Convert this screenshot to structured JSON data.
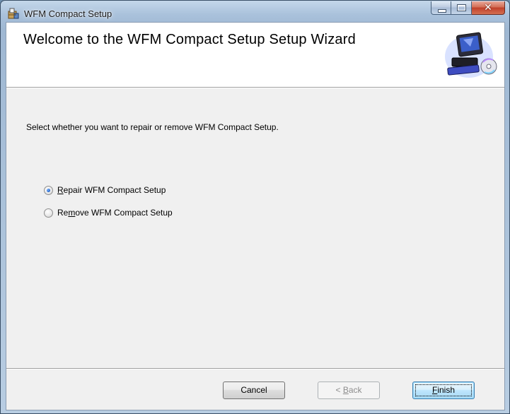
{
  "window": {
    "title": "WFM Compact Setup",
    "icons": {
      "app": "setup-app-icon",
      "minimize": "minimize-icon",
      "maximize": "maximize-icon",
      "close": "close-icon"
    }
  },
  "banner": {
    "title": "Welcome to the WFM Compact Setup Setup Wizard",
    "graphic": "computer-cd-icon"
  },
  "instruction": "Select whether you want to repair or remove WFM Compact Setup.",
  "options": [
    {
      "prefix": "",
      "accel": "R",
      "rest": "epair WFM Compact Setup",
      "selected": true
    },
    {
      "prefix": "Re",
      "accel": "m",
      "rest": "ove WFM Compact Setup",
      "selected": false
    }
  ],
  "buttons": {
    "cancel": "Cancel",
    "back": {
      "symbol": "< ",
      "accel": "B",
      "rest": "ack",
      "enabled": false
    },
    "finish": {
      "accel": "F",
      "rest": "inish",
      "default": true
    }
  }
}
